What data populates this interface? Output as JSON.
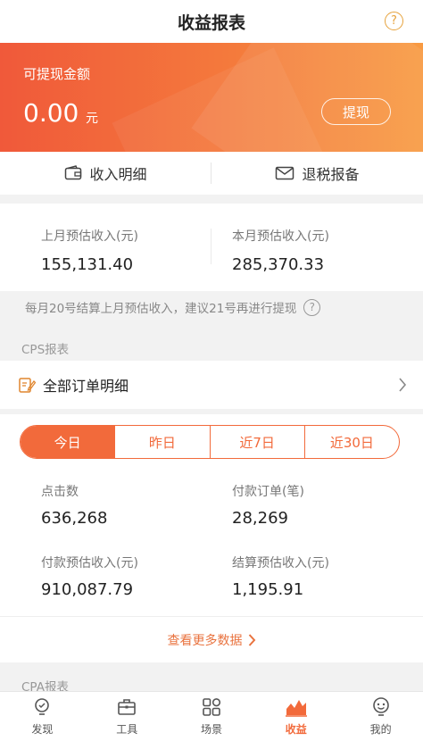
{
  "header": {
    "title": "收益报表",
    "help_glyph": "?"
  },
  "balance": {
    "label": "可提现金额",
    "amount": "0.00",
    "unit": "元",
    "withdraw_label": "提现"
  },
  "quick_links": [
    {
      "label": "收入明细",
      "icon": "wallet-icon"
    },
    {
      "label": "退税报备",
      "icon": "envelope-icon"
    }
  ],
  "monthly": {
    "last_month_label": "上月预估收入(元)",
    "last_month_value": "155,131.40",
    "this_month_label": "本月预估收入(元)",
    "this_month_value": "285,370.33"
  },
  "notice": "每月20号结算上月预估收入，建议21号再进行提现",
  "cps": {
    "section_title": "CPS报表",
    "orders_label": "全部订单明细",
    "tabs": [
      "今日",
      "昨日",
      "近7日",
      "近30日"
    ],
    "active_tab": 0,
    "stats": {
      "clicks_label": "点击数",
      "clicks_value": "636,268",
      "paid_orders_label": "付款订单(笔)",
      "paid_orders_value": "28,269",
      "paid_income_label": "付款预估收入(元)",
      "paid_income_value": "910,087.79",
      "settled_income_label": "结算预估收入(元)",
      "settled_income_value": "1,195.91"
    },
    "more_label": "查看更多数据"
  },
  "cpa": {
    "section_title": "CPA报表"
  },
  "tabbar": [
    {
      "label": "发现",
      "icon": "bulb-icon"
    },
    {
      "label": "工具",
      "icon": "toolbox-icon"
    },
    {
      "label": "场景",
      "icon": "grid-icon"
    },
    {
      "label": "收益",
      "icon": "chart-icon"
    },
    {
      "label": "我的",
      "icon": "user-icon"
    }
  ],
  "colors": {
    "accent": "#f26a3b",
    "banner_start": "#f0593a",
    "banner_end": "#f89a42"
  }
}
